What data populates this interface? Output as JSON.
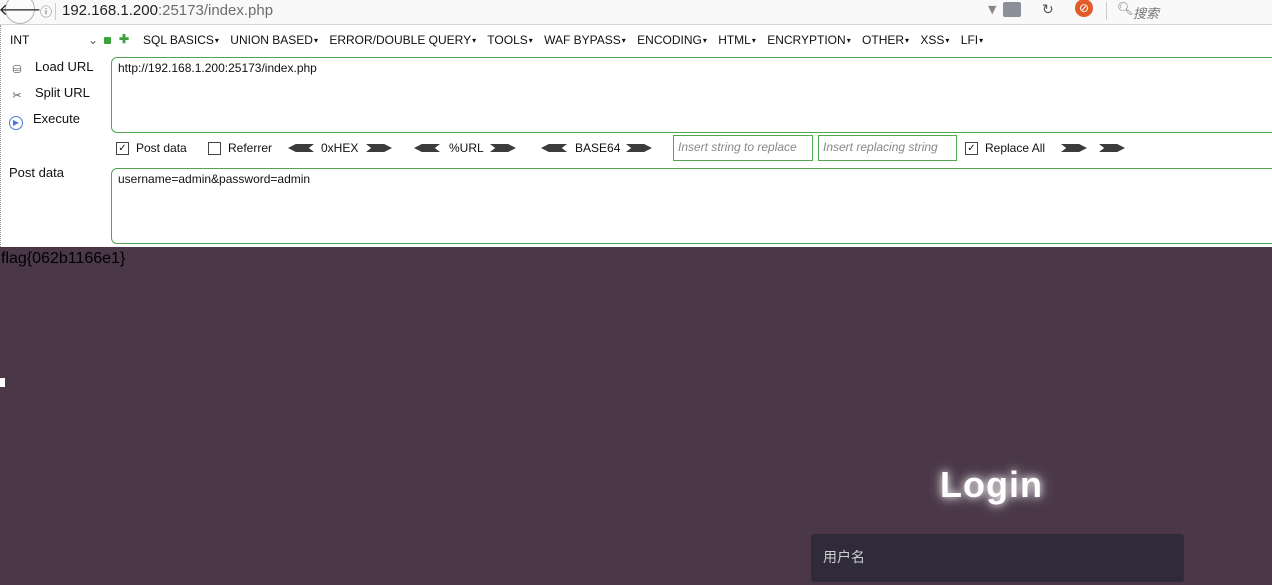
{
  "browser": {
    "url_host": "192.168.1.200",
    "url_rest": ":25173/index.php",
    "search_placeholder": "搜索"
  },
  "hackbar": {
    "int_select": "INT",
    "menu": [
      "SQL BASICS",
      "UNION BASED",
      "ERROR/DOUBLE QUERY",
      "TOOLS",
      "WAF BYPASS",
      "ENCODING",
      "HTML",
      "ENCRYPTION",
      "OTHER",
      "XSS",
      "LFI"
    ],
    "load_url": "Load URL",
    "split_url": "Split URL",
    "execute": "Execute",
    "url_value": "http://192.168.1.200:25173/index.php",
    "post_data_cb": "Post data",
    "referrer_cb": "Referrer",
    "hex": "0xHEX",
    "urlenc": "%URL",
    "base64": "BASE64",
    "insert_replace_ph": "Insert string to replace",
    "insert_replacing_ph": "Insert replacing string",
    "replace_all": "Replace All",
    "post_label": "Post data",
    "post_value": "username=admin&password=admin"
  },
  "page": {
    "flag": "flag{062b1166e1}",
    "login_title": "Login",
    "username_placeholder": "用户名"
  }
}
